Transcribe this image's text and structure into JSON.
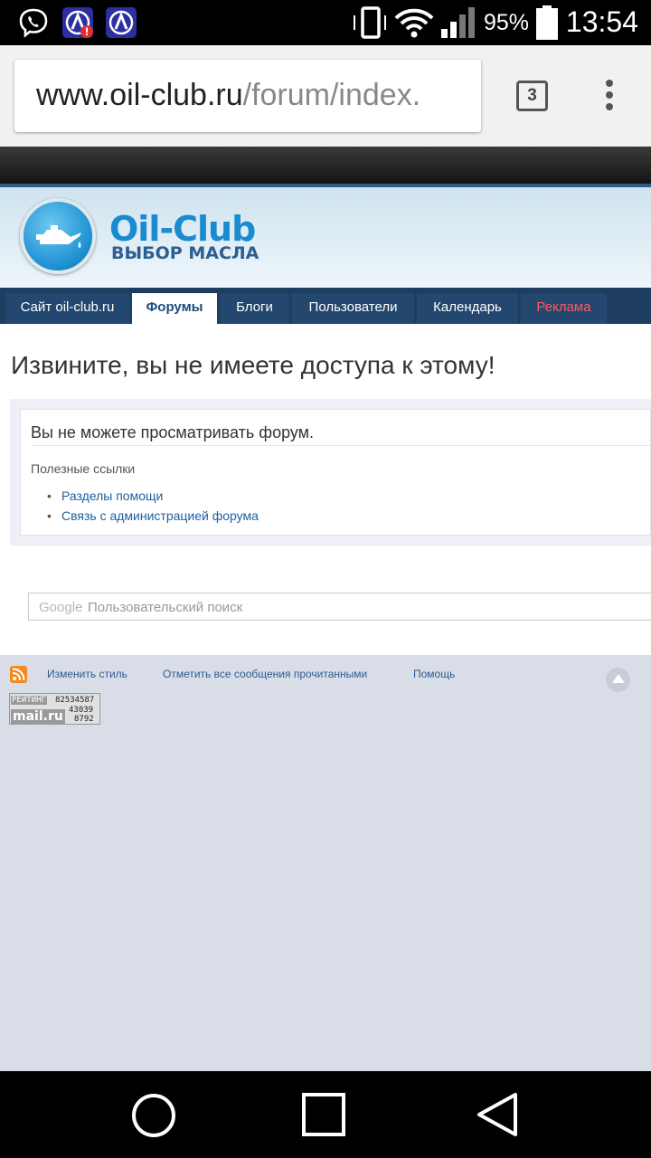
{
  "status_bar": {
    "battery": "95%",
    "time": "13:54",
    "icons": [
      "viber-icon",
      "app-alert-icon",
      "app-icon",
      "rotation-icon",
      "wifi-icon",
      "signal-icon",
      "battery-icon"
    ]
  },
  "browser": {
    "url_host": "www.oil-club.ru",
    "url_path": "/forum/index.",
    "tab_count": "3",
    "icons": [
      "overflow-menu-icon"
    ]
  },
  "site": {
    "logo_title": "Oil-Club",
    "logo_subtitle": "ВЫБОР МАСЛА",
    "nav": [
      "Сайт oil-club.ru",
      "Форумы",
      "Блоги",
      "Пользователи",
      "Календарь",
      "Реклама"
    ],
    "active_nav": "Форумы",
    "colors": {
      "nav_bg": "#1d3e60",
      "link": "#1f5fa0",
      "ad_text": "#ff5a5a",
      "logo_blue": "#1a8bd0"
    }
  },
  "error": {
    "title": "Извините, вы не имеете доступа к этому!",
    "message": "Вы не можете просматривать форум.",
    "useful_links_label": "Полезные ссылки",
    "links": [
      "Разделы помощи",
      "Связь с администрацией форума"
    ]
  },
  "search": {
    "brand": "Google",
    "placeholder": "Пользовательский поиск"
  },
  "footer": {
    "links": [
      "Изменить стиль",
      "Отметить все сообщения прочитанными",
      "Помощь"
    ],
    "counter": {
      "label": "РЕЙТИНГ",
      "value1": "82534587",
      "logo": "mail.ru",
      "value2": "43039",
      "value3": "8792"
    }
  }
}
